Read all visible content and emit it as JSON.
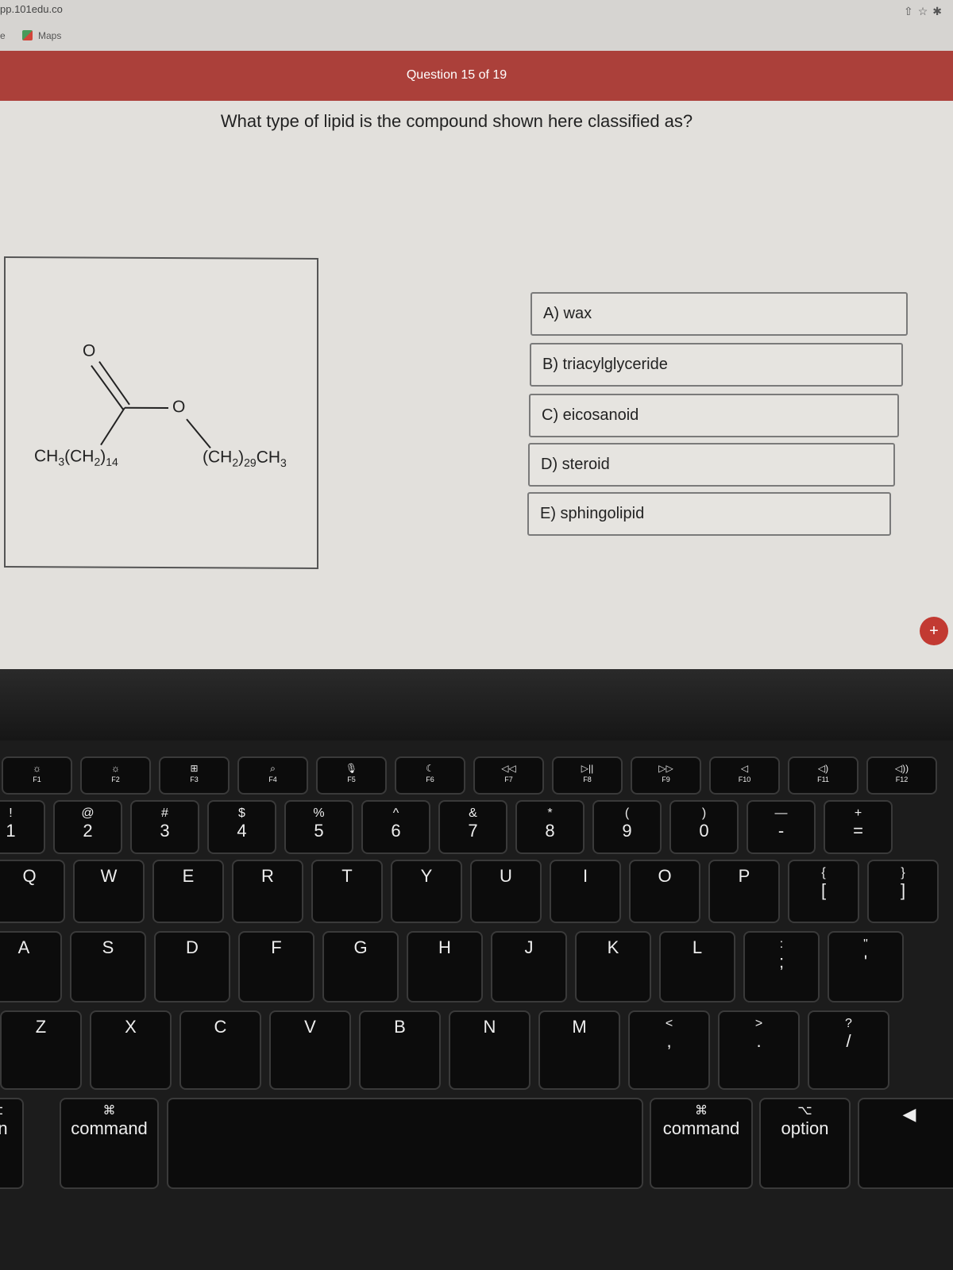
{
  "browser": {
    "url": "pp.101edu.co",
    "bookmarks": [
      "e",
      "Maps"
    ],
    "toolbar_icons": [
      "share-icon",
      "star-icon",
      "extension-icon"
    ]
  },
  "banner": {
    "title": "Question 15 of 19",
    "color": "#ab403a"
  },
  "question": "What type of lipid is the compound shown here classified as?",
  "structure": {
    "atom_o1": "O",
    "atom_o2": "O",
    "left_group": {
      "a": "CH",
      "b": "3",
      "c": "(CH",
      "d": "2",
      "e": ")",
      "f": "14"
    },
    "right_group": {
      "a": "(CH",
      "b": "2",
      "c": ")",
      "d": "29",
      "e": "CH",
      "f": "3"
    }
  },
  "options": [
    "A) wax",
    "B) triacylglyceride",
    "C) eicosanoid",
    "D) steroid",
    "E) sphingolipid"
  ],
  "fab": "+",
  "keyboard": {
    "fn_row": [
      [
        "☼",
        "F1"
      ],
      [
        "☼",
        "F2"
      ],
      [
        "⊞",
        "F3"
      ],
      [
        "⌕",
        "F4"
      ],
      [
        "🎙",
        "F5"
      ],
      [
        "☾",
        "F6"
      ],
      [
        "◁◁",
        "F7"
      ],
      [
        "▷||",
        "F8"
      ],
      [
        "▷▷",
        "F9"
      ],
      [
        "◁",
        "F10"
      ],
      [
        "◁)",
        "F11"
      ],
      [
        "◁))",
        "F12"
      ]
    ],
    "num_row": [
      [
        "!",
        "1"
      ],
      [
        "@",
        "2"
      ],
      [
        "#",
        "3"
      ],
      [
        "$",
        "4"
      ],
      [
        "%",
        "5"
      ],
      [
        "^",
        "6"
      ],
      [
        "&",
        "7"
      ],
      [
        "*",
        "8"
      ],
      [
        "(",
        "9"
      ],
      [
        ")",
        "0"
      ],
      [
        "—",
        "-"
      ],
      [
        "+",
        "="
      ]
    ],
    "qwerty_row": [
      [
        "",
        "Q"
      ],
      [
        "",
        "W"
      ],
      [
        "",
        "E"
      ],
      [
        "",
        "R"
      ],
      [
        "",
        "T"
      ],
      [
        "",
        "Y"
      ],
      [
        "",
        "U"
      ],
      [
        "",
        "I"
      ],
      [
        "",
        "O"
      ],
      [
        "",
        "P"
      ],
      [
        "{",
        "["
      ],
      [
        "}",
        "]"
      ]
    ],
    "asdf_row": [
      [
        "",
        "A"
      ],
      [
        "",
        "S"
      ],
      [
        "",
        "D"
      ],
      [
        "",
        "F"
      ],
      [
        "",
        "G"
      ],
      [
        "",
        "H"
      ],
      [
        "",
        "J"
      ],
      [
        "",
        "K"
      ],
      [
        "",
        "L"
      ],
      [
        ":",
        ";"
      ],
      [
        "\"",
        "'"
      ]
    ],
    "zxcv_row": [
      [
        "",
        "Z"
      ],
      [
        "",
        "X"
      ],
      [
        "",
        "C"
      ],
      [
        "",
        "V"
      ],
      [
        "",
        "B"
      ],
      [
        "",
        "N"
      ],
      [
        "",
        "M"
      ],
      [
        "<",
        ","
      ],
      [
        ">",
        "."
      ],
      [
        "?",
        "/"
      ]
    ],
    "bottom_row": [
      [
        "⌥",
        "ion"
      ],
      [
        "⌘",
        "command"
      ],
      [
        "",
        ""
      ],
      [
        "⌘",
        "command"
      ],
      [
        "⌥",
        "option"
      ],
      [
        "",
        "◀"
      ]
    ]
  }
}
